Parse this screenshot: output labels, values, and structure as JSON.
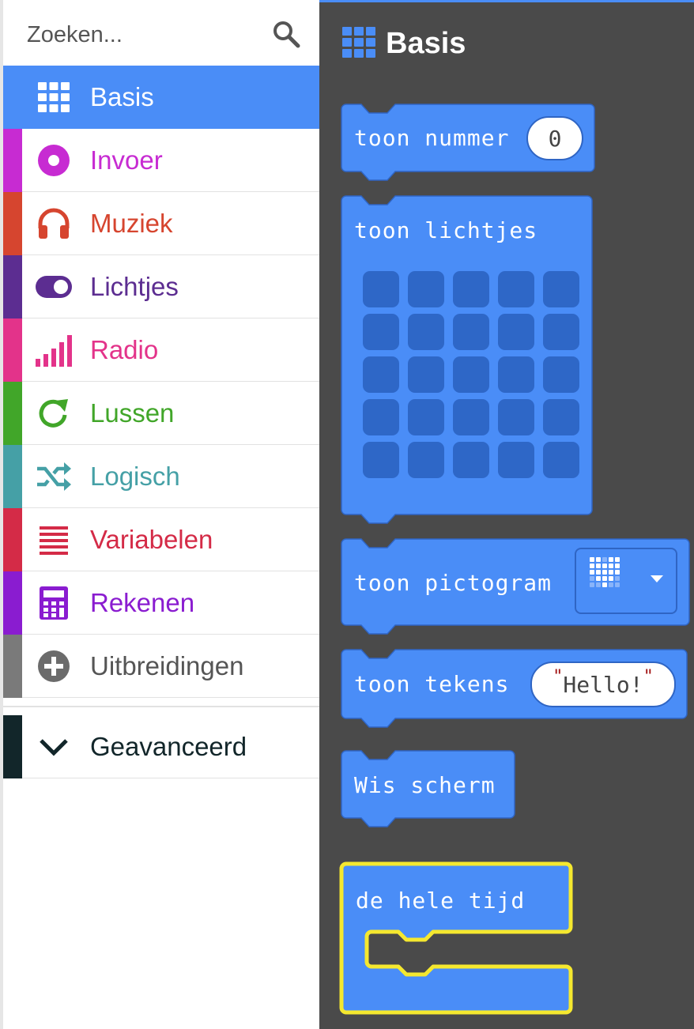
{
  "search": {
    "placeholder": "Zoeken..."
  },
  "categories": [
    {
      "label": "Basis",
      "color": "#4a8df7",
      "icon": "grid-icon",
      "selected": true
    },
    {
      "label": "Invoer",
      "color": "#c72bd2",
      "icon": "circle-dot-icon"
    },
    {
      "label": "Muziek",
      "color": "#d6452f",
      "icon": "headphones-icon"
    },
    {
      "label": "Lichtjes",
      "color": "#5c2d91",
      "icon": "toggle-icon"
    },
    {
      "label": "Radio",
      "color": "#e3338a",
      "icon": "signal-bars-icon"
    },
    {
      "label": "Lussen",
      "color": "#41a629",
      "icon": "refresh-icon"
    },
    {
      "label": "Logisch",
      "color": "#45a0a6",
      "icon": "shuffle-icon"
    },
    {
      "label": "Variabelen",
      "color": "#d42b47",
      "icon": "list-lines-icon"
    },
    {
      "label": "Rekenen",
      "color": "#8a1cd0",
      "icon": "calculator-icon"
    },
    {
      "label": "Uitbreidingen",
      "color": "#7a7a7a",
      "icon": "plus-circle-icon"
    },
    {
      "label": "Geavanceerd",
      "color": "#12262a",
      "icon": "chevron-down-icon"
    }
  ],
  "flyout": {
    "title": "Basis",
    "title_icon": "grid-icon",
    "blocks": {
      "show_number": {
        "text": "toon nummer",
        "value": "0"
      },
      "show_leds": {
        "text": "toon lichtjes"
      },
      "show_icon": {
        "text": "toon pictogram",
        "icon": "heart-icon"
      },
      "show_string": {
        "text": "toon tekens",
        "value": "Hello!"
      },
      "clear_screen": {
        "text": "Wis scherm"
      },
      "forever": {
        "text": "de hele tijd"
      }
    }
  },
  "colors": {
    "block": "#4a8df7",
    "block_border": "#2f65c4",
    "workspace": "#4a4a4a",
    "forever_highlight": "#f5e82f"
  }
}
